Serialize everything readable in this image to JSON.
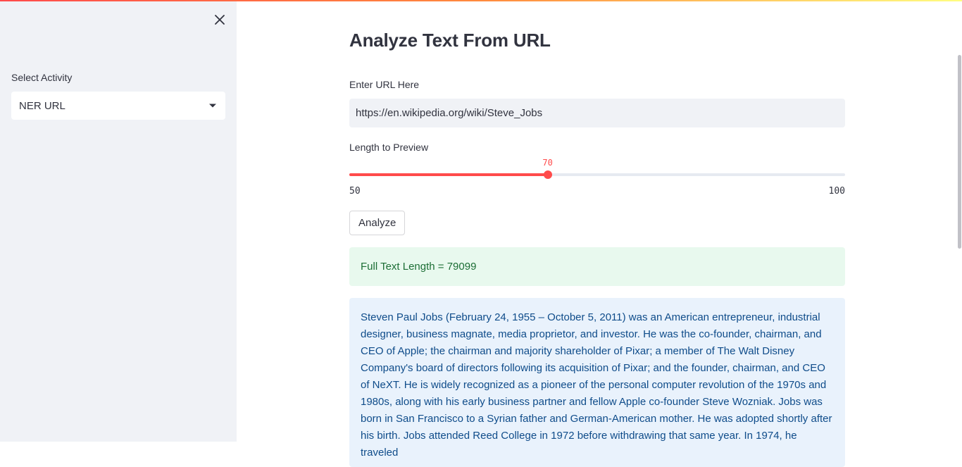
{
  "sidebar": {
    "select_label": "Select Activity",
    "select_value": "NER URL",
    "icons": {
      "close": "close-icon",
      "dropdown": "chevron-down-icon"
    }
  },
  "main": {
    "title": "Analyze Text From URL",
    "url_field": {
      "label": "Enter URL Here",
      "value": "https://en.wikipedia.org/wiki/Steve_Jobs"
    },
    "slider": {
      "label": "Length to Preview",
      "value": "70",
      "min": "50",
      "max": "100"
    },
    "analyze_button": "Analyze",
    "success_message": "Full Text Length = 79099",
    "preview_text": "Steven Paul Jobs (February 24, 1955 – October 5, 2011) was an American entrepreneur, industrial designer, business magnate, media proprietor, and investor. He was the co-founder, chairman, and CEO of Apple; the chairman and majority shareholder of Pixar; a member of The Walt Disney Company's board of directors following its acquisition of Pixar; and the founder, chairman, and CEO of NeXT. He is widely recognized as a pioneer of the personal computer revolution of the 1970s and 1980s, along with his early business partner and fellow Apple co-founder Steve Wozniak. Jobs was born in San Francisco to a Syrian father and German-American mother. He was adopted shortly after his birth. Jobs attended Reed College in 1972 before withdrawing that same year. In 1974, he traveled"
  },
  "colors": {
    "accent": "#ff4b4b",
    "sidebar_bg": "#f0f2f6",
    "success_bg": "#e8f9ee",
    "success_text": "#1c6e35",
    "info_bg": "#e9f2fc",
    "info_text": "#0f4c8a"
  }
}
